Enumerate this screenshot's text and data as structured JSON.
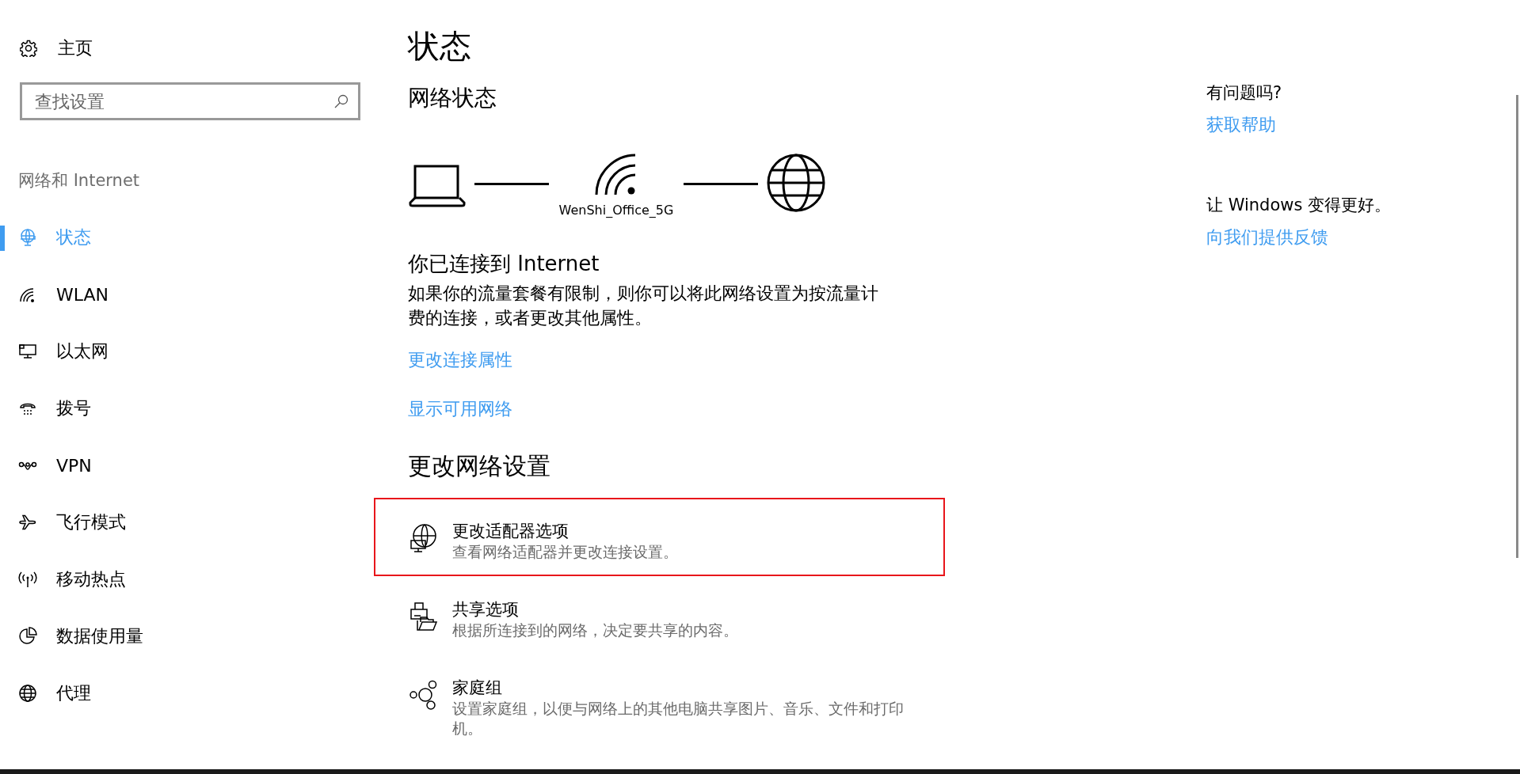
{
  "sidebar": {
    "home": "主页",
    "search": {
      "placeholder": "查找设置"
    },
    "category": "网络和 Internet",
    "items": [
      {
        "label": "状态",
        "kind": "status",
        "selected": true
      },
      {
        "label": "WLAN",
        "kind": "wlan",
        "selected": false
      },
      {
        "label": "以太网",
        "kind": "ethernet",
        "selected": false
      },
      {
        "label": "拨号",
        "kind": "dialup",
        "selected": false
      },
      {
        "label": "VPN",
        "kind": "vpn",
        "selected": false
      },
      {
        "label": "飞行模式",
        "kind": "airplane",
        "selected": false
      },
      {
        "label": "移动热点",
        "kind": "hotspot",
        "selected": false
      },
      {
        "label": "数据使用量",
        "kind": "data",
        "selected": false
      },
      {
        "label": "代理",
        "kind": "proxy",
        "selected": false
      }
    ]
  },
  "main": {
    "title": "状态",
    "network_status": {
      "heading": "网络状态",
      "network_name": "WenShi_Office_5G"
    },
    "connection": {
      "heading": "你已连接到 Internet",
      "description": "如果你的流量套餐有限制，则你可以将此网络设置为按流量计费的连接，或者更改其他属性。",
      "links": [
        "更改连接属性",
        "显示可用网络"
      ]
    },
    "change_settings": {
      "heading": "更改网络设置",
      "options": [
        {
          "kind": "adapter",
          "title": "更改适配器选项",
          "description": "查看网络适配器并更改连接设置。",
          "highlighted": true
        },
        {
          "kind": "sharing",
          "title": "共享选项",
          "description": "根据所连接到的网络，决定要共享的内容。",
          "highlighted": false
        },
        {
          "kind": "homegroup",
          "title": "家庭组",
          "description": "设置家庭组，以便与网络上的其他电脑共享图片、音乐、文件和打印机。",
          "highlighted": false
        }
      ]
    }
  },
  "help": {
    "question": "有问题吗?",
    "help_link": "获取帮助",
    "feedback_prompt": "让 Windows 变得更好。",
    "feedback_link": "向我们提供反馈"
  }
}
